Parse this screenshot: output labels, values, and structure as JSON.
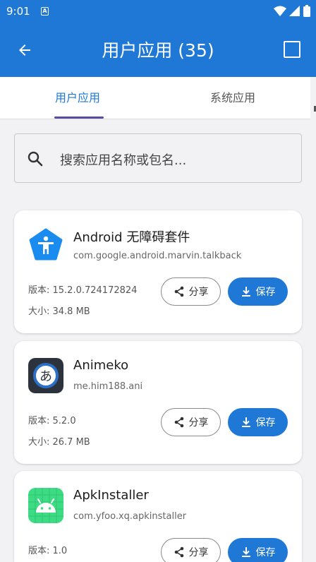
{
  "status_bar": {
    "time": "9:01",
    "badge": "A"
  },
  "toolbar": {
    "title": "用户应用 (35)"
  },
  "tabs": [
    {
      "label": "用户应用",
      "active": true
    },
    {
      "label": "系统应用",
      "active": false
    }
  ],
  "search": {
    "placeholder": "搜索应用名称或包名..."
  },
  "apps": [
    {
      "name": "Android 无障碍套件",
      "package": "com.google.android.marvin.talkback",
      "version": "版本: 15.2.0.724172824",
      "size": "大小: 34.8 MB",
      "share_label": "分享",
      "save_label": "保存",
      "icon": "accessibility-icon"
    },
    {
      "name": "Animeko",
      "package": "me.him188.ani",
      "version": "版本: 5.2.0",
      "size": "大小: 26.7 MB",
      "share_label": "分享",
      "save_label": "保存",
      "icon": "animeko-icon"
    },
    {
      "name": "ApkInstaller",
      "package": "com.yfoo.xq.apkinstaller",
      "version": "版本: 1.0",
      "size": "",
      "share_label": "分享",
      "save_label": "保存",
      "icon": "android-icon"
    }
  ],
  "colors": {
    "primary": "#1f78d6",
    "tab_indicator": "#5a4a9c",
    "background": "#f2f2f4"
  }
}
